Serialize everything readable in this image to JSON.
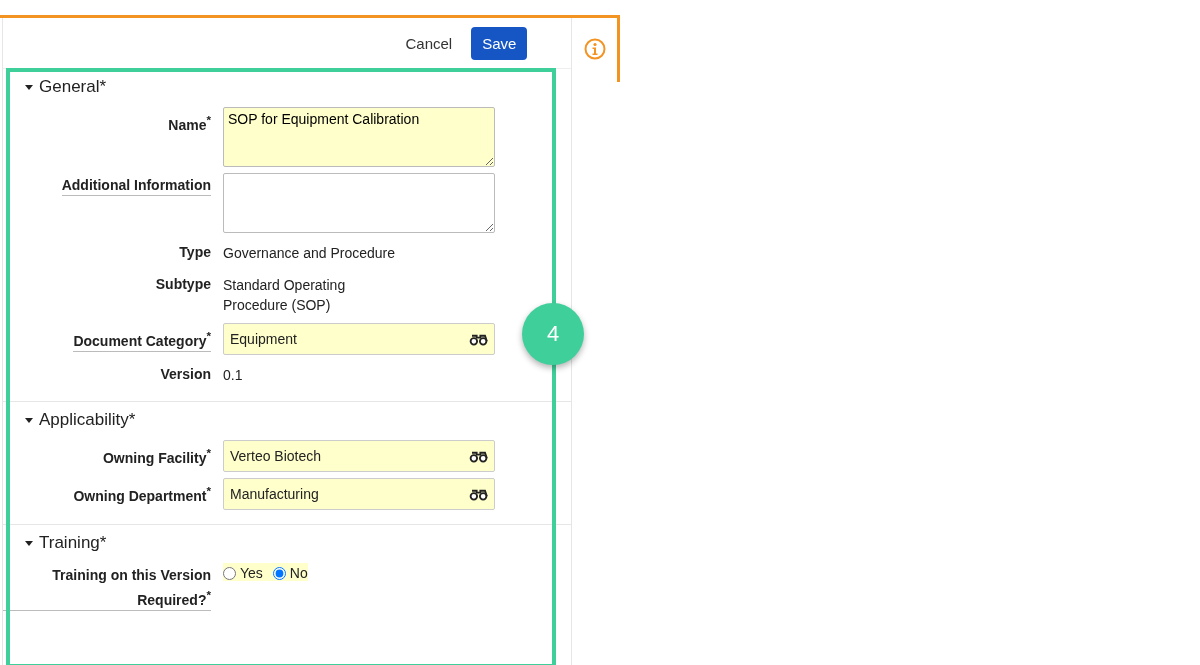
{
  "toolbar": {
    "buttons": [
      {
        "label": "Cancel",
        "kind": "link"
      },
      {
        "label": "Save",
        "kind": "primary"
      }
    ]
  },
  "sections": [
    {
      "title": "General*",
      "expanded": true,
      "fields": [
        {
          "label": "Name$^{*}$",
          "kind": "textarea",
          "value": "SOP for Equipment Calibration",
          "required": true,
          "help": false
        },
        {
          "label": "Additional Information",
          "kind": "textarea",
          "required": false,
          "help": true
        },
        {
          "label": "Type",
          "kind": "static",
          "value": "Governance and Procedure",
          "help": false
        },
        {
          "label": "Subtype",
          "kind": "static",
          "value": "Standard Operating Procedure (SOP)",
          "help": false
        },
        {
          "label": "Document Category$^{*}$",
          "kind": "lookup",
          "value": "Equipment",
          "required": true,
          "help": true
        },
        {
          "label": "Version",
          "kind": "static",
          "value": "0.1",
          "help": false
        }
      ]
    },
    {
      "title": "Applicability*",
      "expanded": true,
      "fields": [
        {
          "label": "Owning Facility$^{*}$",
          "kind": "lookup",
          "value": "Verteo Biotech",
          "required": true,
          "help": false
        },
        {
          "label": "Owning Department$^{*}$",
          "kind": "lookup",
          "value": "Manufacturing",
          "required": true,
          "help": false
        }
      ]
    },
    {
      "title": "Training*",
      "expanded": true,
      "fields": [
        {
          "label": "Training on this Version Required?$^{*}$",
          "kind": "radio",
          "required": true,
          "help": true,
          "options": [
            {
              "label": "Yes",
              "selected": false
            },
            {
              "label": "No",
              "selected": true
            }
          ]
        }
      ]
    }
  ],
  "callout": {
    "number": "4"
  }
}
